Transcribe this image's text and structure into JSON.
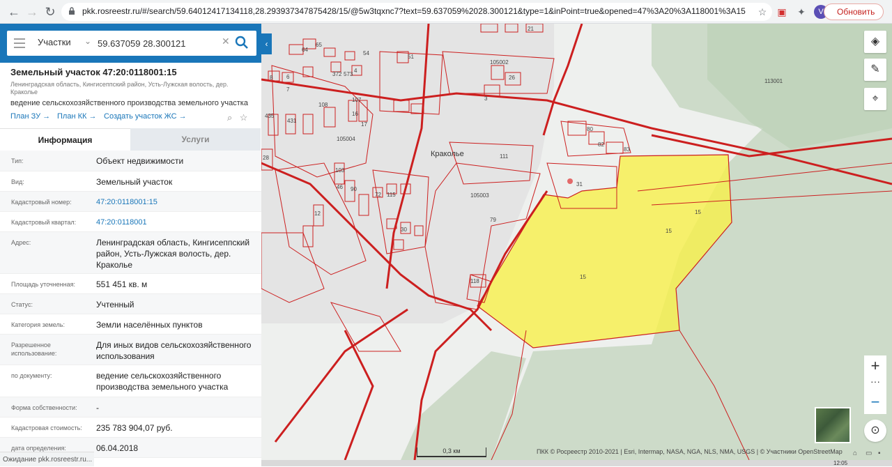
{
  "browser": {
    "url": "pkk.rosreestr.ru/#/search/59.64012417134118,28.293937347875428/15/@5w3tqxnc7?text=59.637059%2028.300121&type=1&inPoint=true&opened=47%3A20%3A118001%3A15",
    "update_label": "Обновить",
    "avatar_letter": "V"
  },
  "search": {
    "type_label": "Участки",
    "query": "59.637059 28.300121"
  },
  "parcel": {
    "title": "Земельный участок 47:20:0118001:15",
    "address_short": "Ленинградская область, Кингисеппский район, Усть-Лужская волость, дер. Краколье",
    "use": "ведение сельскохозяйственного производства земельного участка",
    "links": [
      "План ЗУ",
      "План КК",
      "Создать участок ЖС"
    ]
  },
  "tabs": {
    "info": "Информация",
    "services": "Услуги"
  },
  "info_rows": [
    {
      "label": "Тип:",
      "value": "Объект недвижимости",
      "h": 30
    },
    {
      "label": "Вид:",
      "value": "Земельный участок",
      "h": 29
    },
    {
      "label": "Кадастровый номер:",
      "value": "47:20:0118001:15",
      "link": true,
      "h": 29
    },
    {
      "label": "Кадастровый квартал:",
      "value": "47:20:0118001",
      "link": true,
      "h": 29
    },
    {
      "label": "Адрес:",
      "value": "Ленинградская область, Кингисеппский район, Усть-Лужская волость, дер. Краколье",
      "h": 60
    },
    {
      "label": "Площадь уточненная:",
      "value": "551 451 кв. м",
      "h": 29
    },
    {
      "label": "Статус:",
      "value": "Учтенный",
      "h": 29
    },
    {
      "label": "Категория земель:",
      "value": "Земли населённых пунктов",
      "h": 29
    },
    {
      "label": "Разрешенное использование:",
      "value": "Для иных видов сельскохозяйственного использования",
      "h": 44
    },
    {
      "label": "по документу:",
      "value": "ведение сельскохозяйственного производства земельного участка",
      "h": 46
    },
    {
      "label": "Форма собственности:",
      "value": "-",
      "h": 29
    },
    {
      "label": "Кадастровая стоимость:",
      "value": "235 783 904,07 руб.",
      "h": 29
    },
    {
      "label": "дата определения:",
      "value": "06.04.2018",
      "h": 29
    }
  ],
  "status_text": "Ожидание pkk.rosreestr.ru...",
  "map": {
    "village_label": "Краколье",
    "scale_label": "0,3 км",
    "attribution": "ПКК © Росреестр 2010-2021 | Esri, Intermap, NASA, NGA, NLS, NMA, USGS | © Участники OpenStreetMap",
    "clock": "12:05",
    "parcel_numbers": [
      "65",
      "64",
      "51",
      "21",
      "54",
      "105002",
      "113001",
      "372",
      "573",
      "8",
      "6",
      "4",
      "7",
      "16",
      "17",
      "26",
      "108",
      "107",
      "3",
      "431",
      "435",
      "28",
      "105004",
      "80",
      "82",
      "83",
      "111",
      "31",
      "15",
      "15",
      "103",
      "46",
      "90",
      "72",
      "115",
      "105003",
      "79",
      "12",
      "30",
      "118",
      "15"
    ],
    "highlight_color": "#f7f04a",
    "boundary_color": "#cc1f1f"
  }
}
